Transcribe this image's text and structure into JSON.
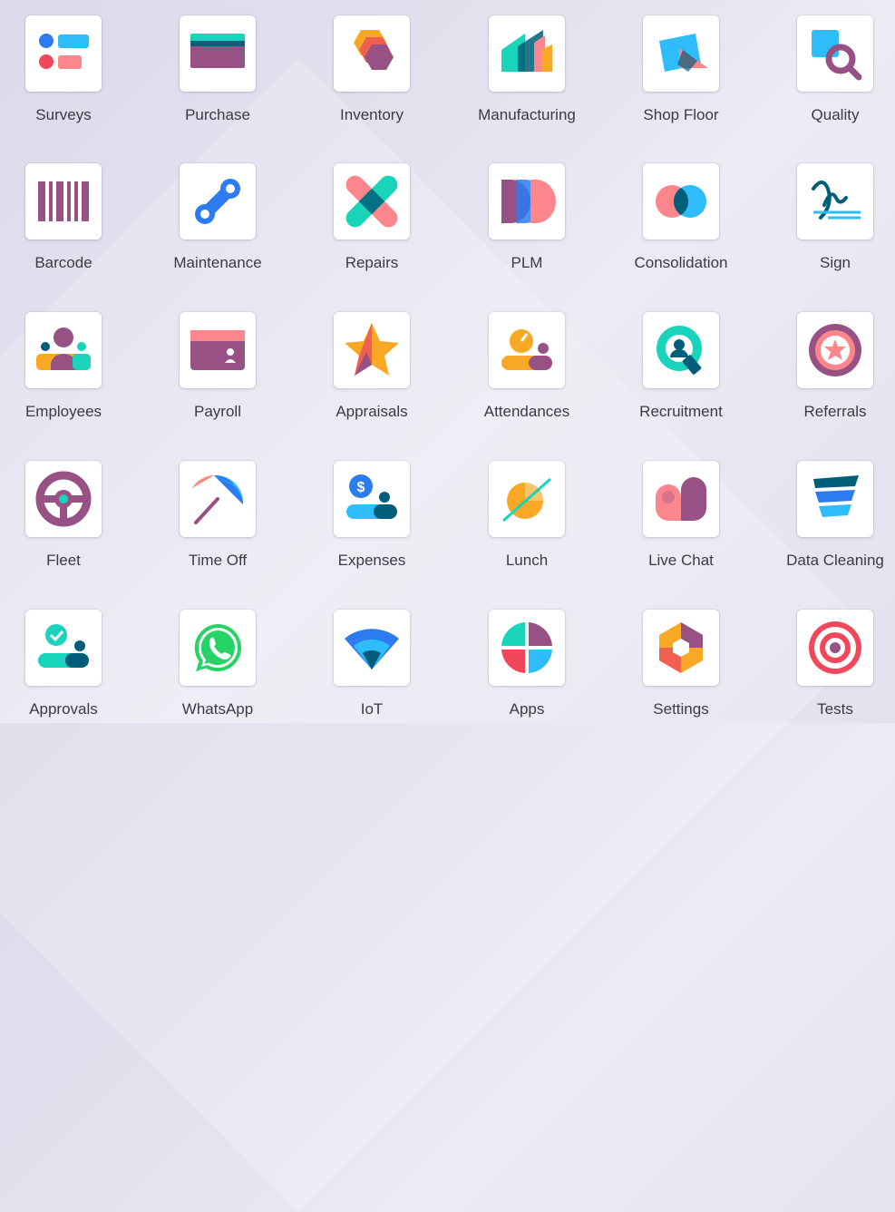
{
  "apps": [
    {
      "label": "Surveys",
      "icon": "surveys-icon"
    },
    {
      "label": "Purchase",
      "icon": "purchase-icon"
    },
    {
      "label": "Inventory",
      "icon": "inventory-icon"
    },
    {
      "label": "Manufacturing",
      "icon": "manufacturing-icon"
    },
    {
      "label": "Shop Floor",
      "icon": "shop-floor-icon"
    },
    {
      "label": "Quality",
      "icon": "quality-icon"
    },
    {
      "label": "Barcode",
      "icon": "barcode-icon"
    },
    {
      "label": "Maintenance",
      "icon": "maintenance-icon"
    },
    {
      "label": "Repairs",
      "icon": "repairs-icon"
    },
    {
      "label": "PLM",
      "icon": "plm-icon"
    },
    {
      "label": "Consolidation",
      "icon": "consolidation-icon"
    },
    {
      "label": "Sign",
      "icon": "sign-icon"
    },
    {
      "label": "Employees",
      "icon": "employees-icon"
    },
    {
      "label": "Payroll",
      "icon": "payroll-icon"
    },
    {
      "label": "Appraisals",
      "icon": "appraisals-icon"
    },
    {
      "label": "Attendances",
      "icon": "attendances-icon"
    },
    {
      "label": "Recruitment",
      "icon": "recruitment-icon"
    },
    {
      "label": "Referrals",
      "icon": "referrals-icon"
    },
    {
      "label": "Fleet",
      "icon": "fleet-icon"
    },
    {
      "label": "Time Off",
      "icon": "time-off-icon"
    },
    {
      "label": "Expenses",
      "icon": "expenses-icon"
    },
    {
      "label": "Lunch",
      "icon": "lunch-icon"
    },
    {
      "label": "Live Chat",
      "icon": "live-chat-icon"
    },
    {
      "label": "Data Cleaning",
      "icon": "data-cleaning-icon"
    },
    {
      "label": "Approvals",
      "icon": "approvals-icon"
    },
    {
      "label": "WhatsApp",
      "icon": "whatsapp-icon"
    },
    {
      "label": "IoT",
      "icon": "iot-icon"
    },
    {
      "label": "Apps",
      "icon": "apps-icon"
    },
    {
      "label": "Settings",
      "icon": "settings-icon"
    },
    {
      "label": "Tests",
      "icon": "tests-icon"
    }
  ],
  "colors": {
    "purple": "#985184",
    "teal": "#1AD3BB",
    "blue": "#2EBCFA",
    "dark_blue": "#005E7A",
    "coral": "#FC868B",
    "orange": "#F9A825",
    "label_text": "#3b3b44"
  }
}
